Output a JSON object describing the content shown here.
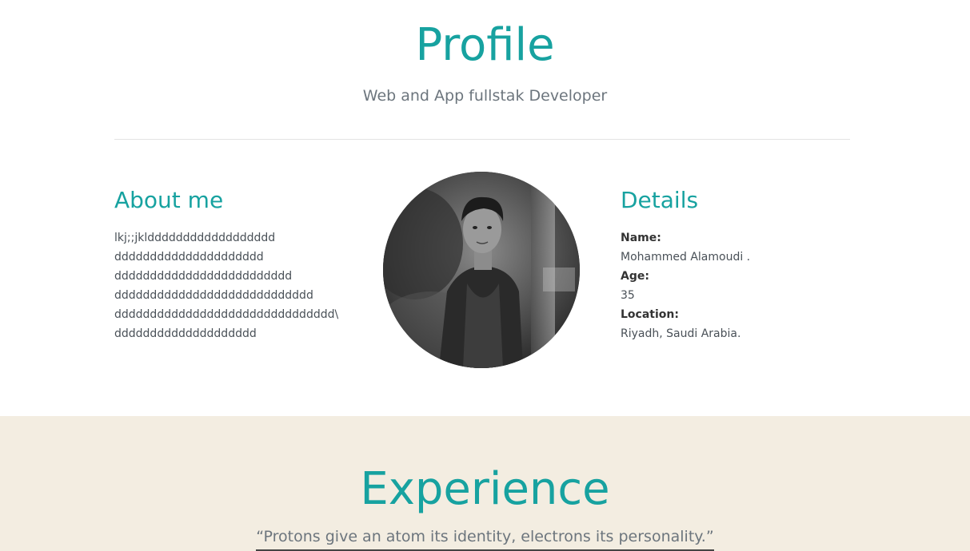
{
  "header": {
    "title": "Profile",
    "subtitle": "Web and App fullstak Developer"
  },
  "about": {
    "heading": "About me",
    "lines": [
      "lkj;;jkldddddddddddddddddd",
      "ddddddddddddddddddddd",
      "ddddddddddddddddddddddddd",
      "dddddddddddddddddddddddddddd",
      "ddddddddddddddddddddddddddddddd\\",
      "dddddddddddddddddddd"
    ]
  },
  "avatar": {
    "icon": "profile-photo"
  },
  "details": {
    "heading": "Details",
    "name_label": "Name:",
    "name_value": "Mohammed Alamoudi .",
    "age_label": "Age:",
    "age_value": "35",
    "location_label": "Location:",
    "location_value": "Riyadh, Saudi Arabia."
  },
  "experience": {
    "title": "Experience",
    "quote": "“Protons give an atom its identity, electrons its personality.”"
  },
  "colors": {
    "accent": "#17a2a0",
    "experience_bg": "#f3ede1"
  }
}
